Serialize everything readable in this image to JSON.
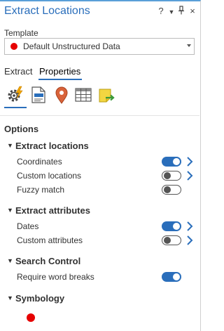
{
  "window": {
    "title": "Extract Locations",
    "help_glyph": "?",
    "menu_glyph": "▼",
    "pin_glyph": "⊥",
    "close_glyph": "×"
  },
  "template": {
    "label": "Template",
    "selected": "Default Unstructured Data",
    "dot_color": "#e60000"
  },
  "tabs": [
    {
      "label": "Extract",
      "active": false
    },
    {
      "label": "Properties",
      "active": true
    }
  ],
  "icon_tabs": [
    {
      "name": "gear-lightning-icon",
      "active": true
    },
    {
      "name": "document-icon",
      "active": false
    },
    {
      "name": "location-pin-icon",
      "active": false
    },
    {
      "name": "table-icon",
      "active": false
    },
    {
      "name": "export-note-icon",
      "active": false
    }
  ],
  "options_heading": "Options",
  "sections": {
    "extract_locations": {
      "title": "Extract locations",
      "rows": [
        {
          "label": "Coordinates",
          "on": true,
          "has_arrow": true
        },
        {
          "label": "Custom locations",
          "on": false,
          "has_arrow": true
        },
        {
          "label": "Fuzzy match",
          "on": false,
          "has_arrow": false
        }
      ]
    },
    "extract_attributes": {
      "title": "Extract attributes",
      "rows": [
        {
          "label": "Dates",
          "on": true,
          "has_arrow": true
        },
        {
          "label": "Custom attributes",
          "on": false,
          "has_arrow": true
        }
      ]
    },
    "search_control": {
      "title": "Search Control",
      "rows": [
        {
          "label": "Require word breaks",
          "on": true,
          "has_arrow": false
        }
      ]
    },
    "symbology": {
      "title": "Symbology",
      "symbol_color": "#e60000"
    }
  },
  "colors": {
    "accent": "#2a6ebb",
    "title": "#2a6ebb",
    "symbol": "#e60000"
  }
}
